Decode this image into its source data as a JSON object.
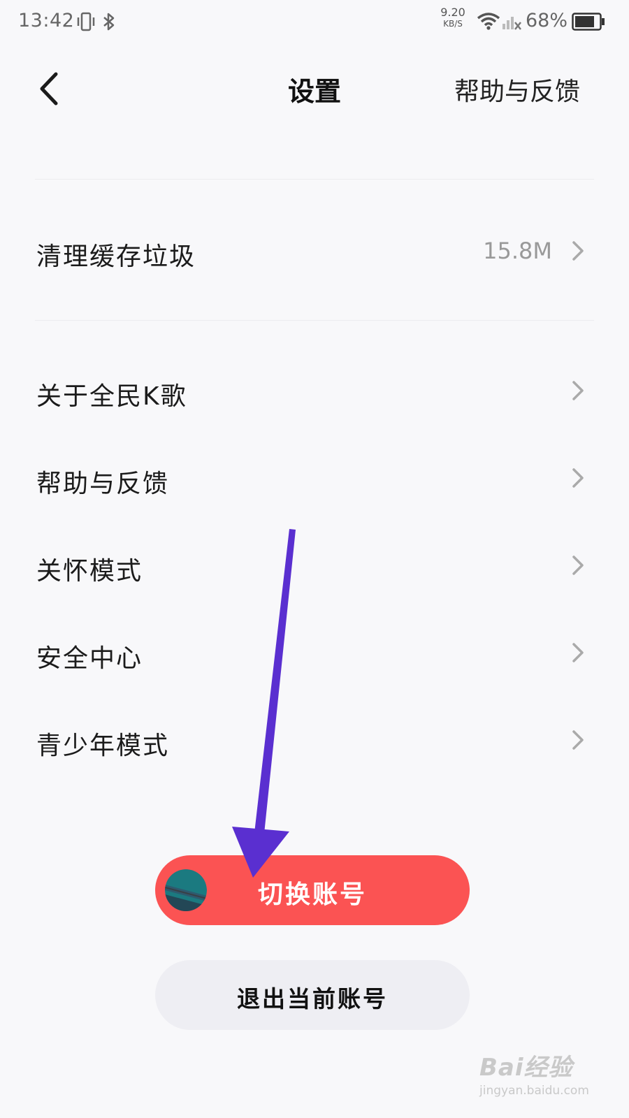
{
  "status_bar": {
    "time": "13:42",
    "net_speed_value": "9.20",
    "net_speed_unit": "KB/S",
    "battery_percent": "68%"
  },
  "header": {
    "title": "设置",
    "help_label": "帮助与反馈"
  },
  "settings": {
    "clear_cache": {
      "label": "清理缓存垃圾",
      "value": "15.8M"
    },
    "items": [
      {
        "label": "关于全民K歌"
      },
      {
        "label": "帮助与反馈"
      },
      {
        "label": "关怀模式"
      },
      {
        "label": "安全中心"
      },
      {
        "label": "青少年模式"
      }
    ]
  },
  "buttons": {
    "switch_account": "切换账号",
    "logout": "退出当前账号"
  },
  "watermark": {
    "brand": "Bai经验",
    "url": "jingyan.baidu.com"
  },
  "colors": {
    "accent_red": "#fb5353",
    "annotation_arrow": "#5a2fd0"
  }
}
